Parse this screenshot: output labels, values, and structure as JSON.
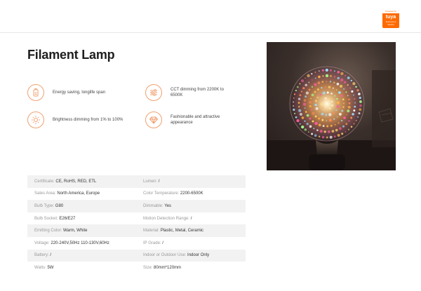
{
  "badge": {
    "powered": "Powered by",
    "brand": "tuya",
    "sub": "Smart Home Solution"
  },
  "title": "Filament Lamp",
  "features": [
    {
      "icon": "battery-icon",
      "text": "Energy saving, longlife span"
    },
    {
      "icon": "sliders-icon",
      "text": "CCT dimming from 2200K to 6500K"
    },
    {
      "icon": "sun-icon",
      "text": "Brightness dimming from 1% to 100%"
    },
    {
      "icon": "diamond-icon",
      "text": "Fashionable and attractive appearance"
    }
  ],
  "specs": [
    [
      {
        "label": "Certificate:",
        "value": "CE, RoHS, RED, ETL"
      },
      {
        "label": "Lumen:",
        "value": "/"
      }
    ],
    [
      {
        "label": "Sales Area:",
        "value": "North America, Europe"
      },
      {
        "label": "Color Temperature:",
        "value": "2200-6500K"
      }
    ],
    [
      {
        "label": "Bulb Type:",
        "value": "G80"
      },
      {
        "label": "Dimmable:",
        "value": "Yes"
      }
    ],
    [
      {
        "label": "Bulb Socket:",
        "value": "E26/E27"
      },
      {
        "label": "Motion Detection Range:",
        "value": "/"
      }
    ],
    [
      {
        "label": "Emitting Color:",
        "value": "Warm, White"
      },
      {
        "label": "Material:",
        "value": "Plastic, Metal, Ceramic"
      }
    ],
    [
      {
        "label": "Voltage:",
        "value": "220-240V,50Hz  110-130V,60Hz"
      },
      {
        "label": "IP Grade:",
        "value": "/"
      }
    ],
    [
      {
        "label": "Battery:",
        "value": "/"
      },
      {
        "label": "Indoor or Outdoor Use:",
        "value": "Indoor Only"
      }
    ],
    [
      {
        "label": "Watts:",
        "value": "5W"
      },
      {
        "label": "Size:",
        "value": "80mm*120mm"
      }
    ]
  ],
  "colors": {
    "accent": "#f0a070",
    "badge": "#ff6a00",
    "row_shade": "#f2f2f2"
  }
}
